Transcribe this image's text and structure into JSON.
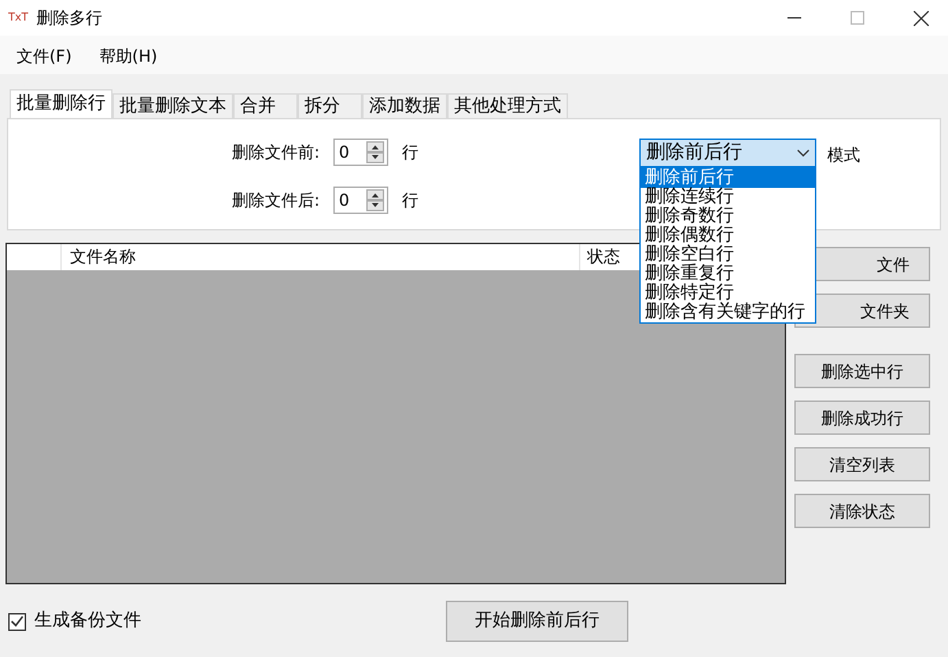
{
  "window": {
    "title": "删除多行",
    "logo": "TxT"
  },
  "menu": [
    "文件(F)",
    "帮助(H)"
  ],
  "tabs": [
    {
      "label": "批量删除行",
      "selected": true
    },
    {
      "label": "批量删除文本",
      "selected": false
    },
    {
      "label": "合并",
      "selected": false
    },
    {
      "label": "拆分",
      "selected": false
    },
    {
      "label": "添加数据",
      "selected": false
    },
    {
      "label": "其他处理方式",
      "selected": false
    }
  ],
  "counts": [
    {
      "label": "删除文件前:",
      "value": "0",
      "unit": "行"
    },
    {
      "label": "删除文件后:",
      "value": "0",
      "unit": "行"
    }
  ],
  "mode": {
    "value": "删除前后行",
    "label": "模式",
    "expanded": true,
    "options": [
      {
        "label": "删除前后行",
        "selected": true
      },
      {
        "label": "删除连续行",
        "selected": false
      },
      {
        "label": "删除奇数行",
        "selected": false
      },
      {
        "label": "删除偶数行",
        "selected": false
      },
      {
        "label": "删除空白行",
        "selected": false
      },
      {
        "label": "删除重复行",
        "selected": false
      },
      {
        "label": "删除特定行",
        "selected": false
      },
      {
        "label": "删除含有关键字的行",
        "selected": false
      }
    ]
  },
  "table": {
    "columns": [
      "",
      "文件名称",
      "状态"
    ]
  },
  "side_buttons": [
    "文件",
    "文件夹",
    "删除选中行",
    "删除成功行",
    "清空列表",
    "清除状态"
  ],
  "backup": {
    "label": "生成备份文件",
    "checked": true
  },
  "start_button": "开始删除前后行"
}
